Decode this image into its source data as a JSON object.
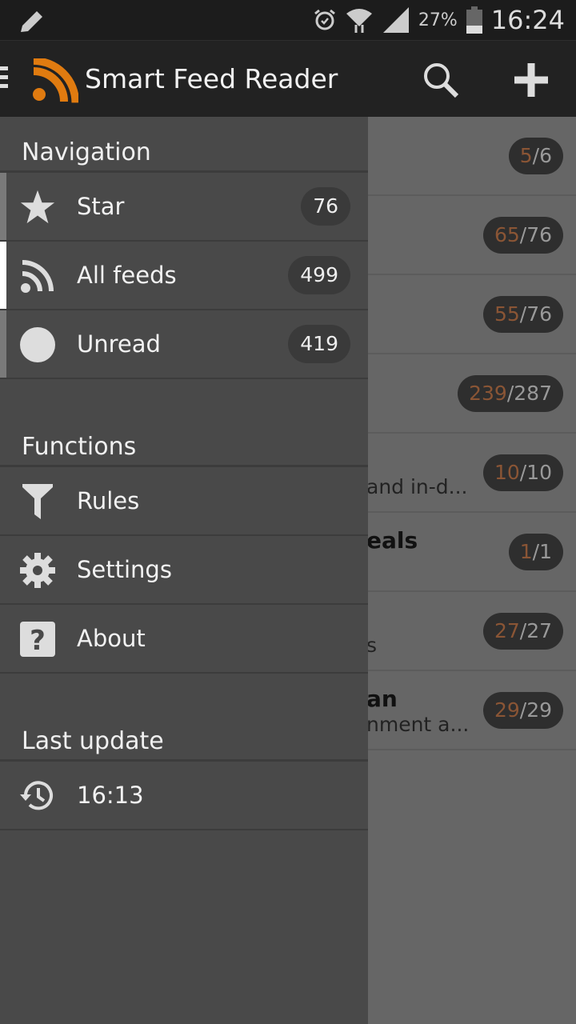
{
  "status_bar": {
    "battery": "27%",
    "time": "16:24",
    "icons": [
      "pencil-icon",
      "alarm-icon",
      "wifi-icon",
      "signal-icon",
      "battery-icon"
    ]
  },
  "action_bar": {
    "title": "Smart Feed Reader",
    "accent": "#e07b10"
  },
  "background_list": [
    {
      "title": "",
      "subtitle": "",
      "unread": "5",
      "total": "6"
    },
    {
      "title": "",
      "subtitle": "",
      "unread": "65",
      "total": "76"
    },
    {
      "title": "",
      "subtitle": "",
      "unread": "55",
      "total": "76"
    },
    {
      "title": "",
      "subtitle": "",
      "unread": "239",
      "total": "287"
    },
    {
      "title": "",
      "subtitle": "and in-d...",
      "unread": "10",
      "total": "10"
    },
    {
      "title": "eals",
      "subtitle": "",
      "unread": "1",
      "total": "1"
    },
    {
      "title": "",
      "subtitle": "s",
      "unread": "27",
      "total": "27"
    },
    {
      "title": "an",
      "subtitle": "nment a...",
      "unread": "29",
      "total": "29"
    }
  ],
  "drawer": {
    "navigation": {
      "header": "Navigation",
      "items": [
        {
          "label": "Star",
          "count": "76",
          "icon": "star-icon"
        },
        {
          "label": "All feeds",
          "count": "499",
          "icon": "rss-icon",
          "active": true
        },
        {
          "label": "Unread",
          "count": "419",
          "icon": "circle-icon"
        }
      ]
    },
    "functions": {
      "header": "Functions",
      "items": [
        {
          "label": "Rules",
          "icon": "filter-icon"
        },
        {
          "label": "Settings",
          "icon": "gear-icon"
        },
        {
          "label": "About",
          "icon": "help-icon"
        }
      ]
    },
    "last_update": {
      "header": "Last update",
      "time": "16:13",
      "icon": "history-icon"
    }
  }
}
